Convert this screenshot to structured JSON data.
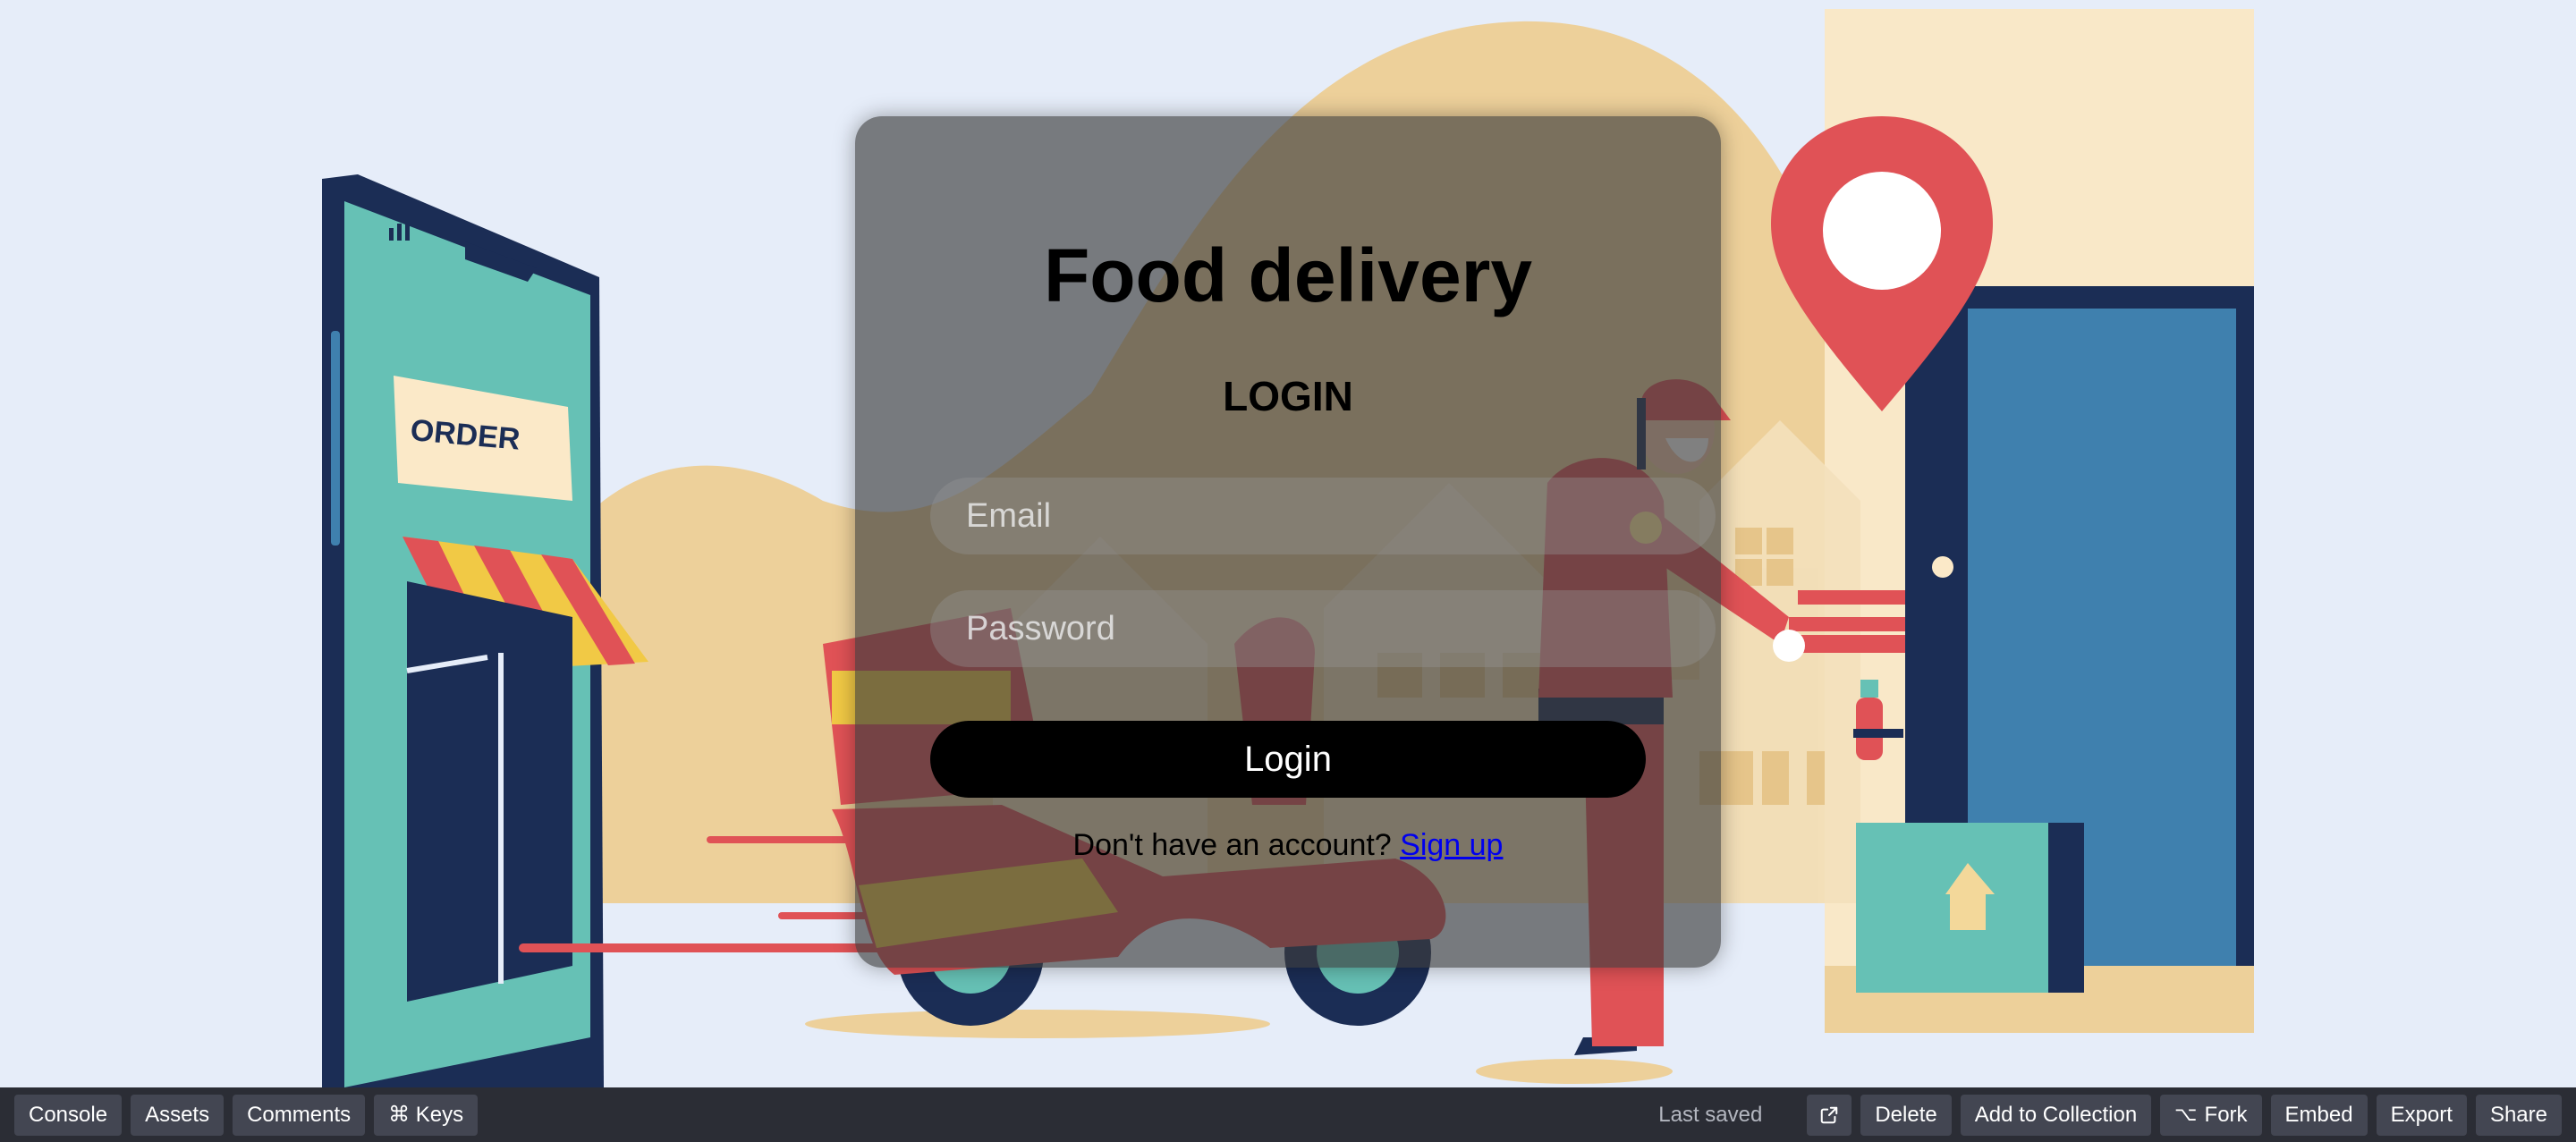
{
  "login_card": {
    "title": "Food delivery",
    "subtitle": "LOGIN",
    "email_placeholder": "Email",
    "email_value": "",
    "password_placeholder": "Password",
    "password_value": "",
    "login_label": "Login",
    "signup_prompt": "Don't have an account?",
    "signup_link": "Sign up"
  },
  "illustration": {
    "order_sign": "ORDER"
  },
  "toolbar": {
    "left": [
      {
        "label": "Console"
      },
      {
        "label": "Assets"
      },
      {
        "label": "Comments"
      },
      {
        "label": "⌘ Keys"
      }
    ],
    "last_saved": "Last saved",
    "open_icon": "external-link-icon",
    "delete": "Delete",
    "add_to_collection": "Add to Collection",
    "fork_glyph": "⌥",
    "fork": "Fork",
    "embed": "Embed",
    "export": "Export",
    "share": "Share"
  },
  "colors": {
    "background": "#e6edf9",
    "sand": "#edd09a",
    "teal": "#66c1b5",
    "navy": "#1b2d55",
    "red": "#e05256",
    "yellow": "#f1c945",
    "door_blue": "#3f80ae",
    "toolbar": "#2b2d35",
    "toolbar_button": "#434652"
  }
}
